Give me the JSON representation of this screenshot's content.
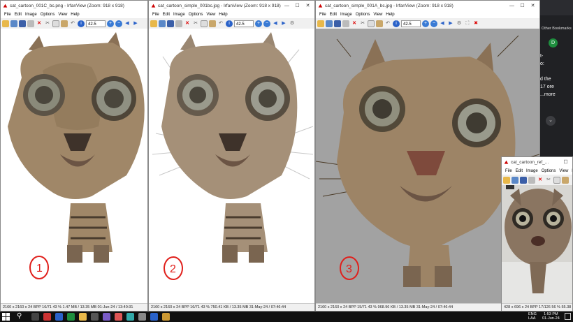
{
  "menu": [
    "File",
    "Edit",
    "Image",
    "Options",
    "View",
    "Help"
  ],
  "colors": {
    "desktop": "#1b1b1b",
    "viewer_white": "#ffffff",
    "viewer_gray": "#a2a2a2",
    "annotation_red": "#e0201c",
    "chrome_dark": "#202124"
  },
  "windows": [
    {
      "title": "cat_cartoon_001C_bc.png - IrfanView (Zoom: 918 x 918)",
      "zoom": "42.5",
      "status": "2160 x 2160 x 24 BPP   16/71   43 %   1.47 MB / 13.35 MB   01-Jun-24 / 13:40:31",
      "label": "1"
    },
    {
      "title": "cat_cartoon_simple_001bc.jpg - IrfanView (Zoom: 918 x 918)",
      "zoom": "42.5",
      "status": "2160 x 2160 x 24 BPP   16/71   43 %   750.41 KB / 13.35 MB   31-May-24 / 07:46:44",
      "label": "2"
    },
    {
      "title": "cat_cartoon_simple_001A_bc.jpg - IrfanView (Zoom: 918 x 918)",
      "zoom": "42.5",
      "status": "2160 x 2160 x 24 BPP   15/71   43 %   968.96 KB / 13.35 MB   31-May-24 / 07:46:44",
      "label": "3"
    },
    {
      "title": "cat_cartoon_ref_...",
      "zoom": "",
      "status": "428 x 696 x 24 BPP   17/126   56 %   55.38 KB"
    }
  ],
  "browser": {
    "bookmarks_label": "Other Bookmarks",
    "avatar_letter": "D",
    "text_lines": [
      "t-",
      "o:",
      "",
      "d the",
      "17 ore",
      "...more"
    ]
  },
  "taskbar": {
    "lang_1": "ENG",
    "lang_2": "LAA",
    "time": "1:53 PM",
    "date": "01-Jun-24"
  }
}
